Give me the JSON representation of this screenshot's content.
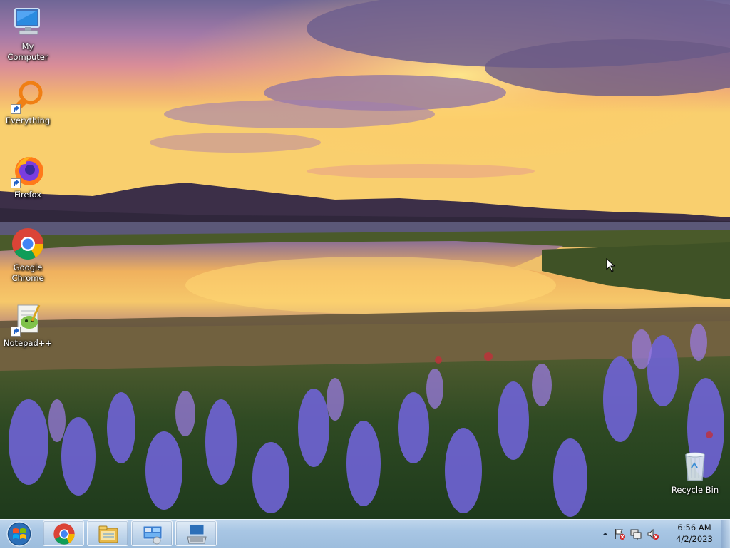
{
  "desktop": {
    "icons": [
      {
        "label": "My Computer",
        "icon": "computer-icon"
      },
      {
        "label": "Everything",
        "icon": "everything-icon"
      },
      {
        "label": "Firefox",
        "icon": "firefox-icon"
      },
      {
        "label": "Google\nChrome",
        "icon": "chrome-icon"
      },
      {
        "label": "Notepad++",
        "icon": "notepadpp-icon"
      },
      {
        "label": "Recycle Bin",
        "icon": "recycle-bin-icon"
      }
    ]
  },
  "taskbar": {
    "start": {
      "icon": "windows-start-icon"
    },
    "pinned": [
      {
        "icon": "chrome-icon"
      },
      {
        "icon": "file-explorer-icon"
      },
      {
        "icon": "control-panel-icon"
      },
      {
        "icon": "on-screen-keyboard-icon"
      }
    ],
    "tray": {
      "icons": [
        "show-hidden-icons-icon",
        "action-center-flag-icon",
        "network-icon",
        "volume-muted-icon"
      ],
      "time": "6:56 AM",
      "date": "4/2/2023"
    }
  }
}
